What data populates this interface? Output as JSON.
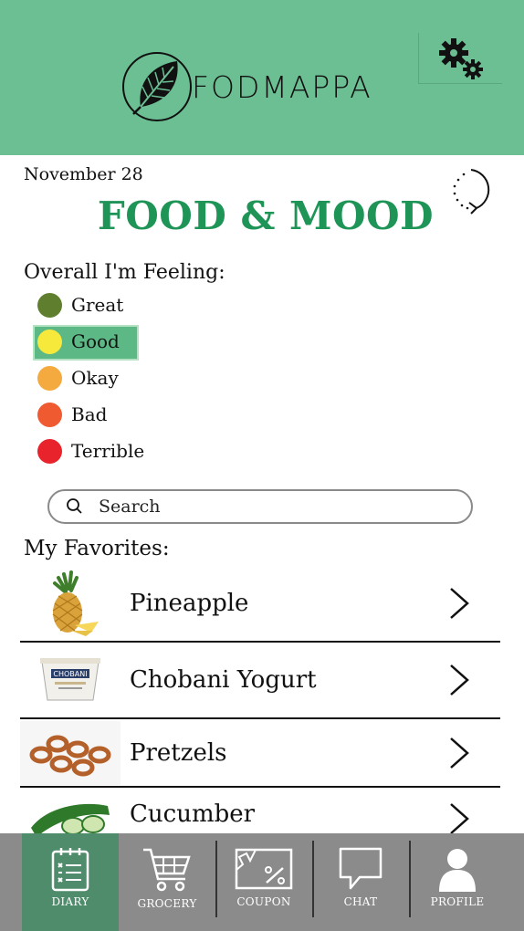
{
  "app": {
    "name": "FODMAPPA"
  },
  "header": {
    "settings_icon": "gears-icon"
  },
  "date": "November 28",
  "title": "FOOD & MOOD",
  "mood": {
    "label": "Overall I'm Feeling:",
    "selected": "Good",
    "options": [
      {
        "label": "Great",
        "color": "#5f7f2e"
      },
      {
        "label": "Good",
        "color": "#f7e93b"
      },
      {
        "label": "Okay",
        "color": "#f4aa3f"
      },
      {
        "label": "Bad",
        "color": "#ef5a30"
      },
      {
        "label": "Terrible",
        "color": "#e8232c"
      }
    ]
  },
  "search": {
    "placeholder": "Search"
  },
  "favorites": {
    "label": "My Favorites:",
    "items": [
      {
        "name": "Pineapple",
        "icon": "pineapple-image"
      },
      {
        "name": "Chobani Yogurt",
        "icon": "yogurt-image"
      },
      {
        "name": "Pretzels",
        "icon": "pretzels-image"
      },
      {
        "name": "Cucumber",
        "icon": "cucumber-image"
      }
    ]
  },
  "nav": {
    "active": "DIARY",
    "items": [
      {
        "label": "DIARY",
        "icon": "diary-icon"
      },
      {
        "label": "GROCERY",
        "icon": "cart-icon"
      },
      {
        "label": "COUPON",
        "icon": "coupon-icon"
      },
      {
        "label": "CHAT",
        "icon": "chat-icon"
      },
      {
        "label": "PROFILE",
        "icon": "profile-icon"
      }
    ]
  }
}
